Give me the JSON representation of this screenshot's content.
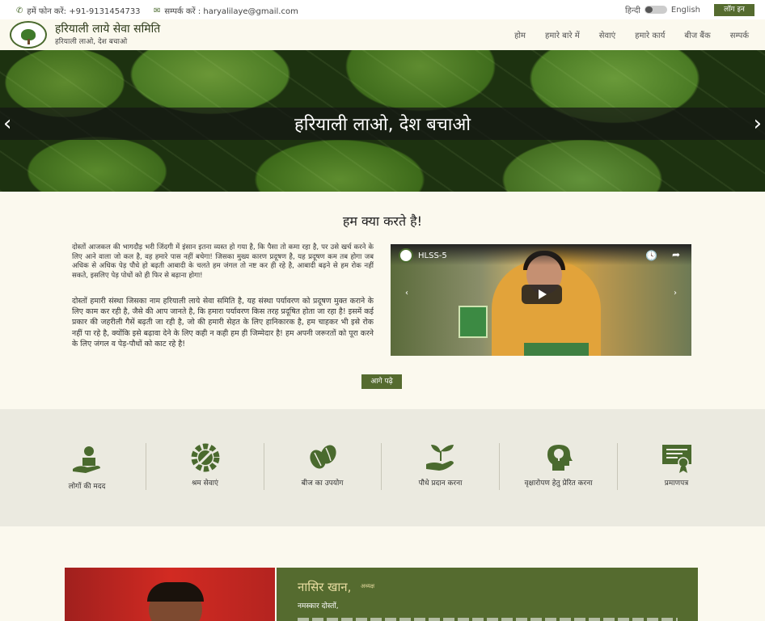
{
  "topbar": {
    "phone": "हमें फोन करें: +91-9131454733",
    "email": "सम्पर्क करें : haryalilaye@gmail.com",
    "lang_hindi": "हिन्दी",
    "lang_english": "English",
    "login_label": "लॉग इन"
  },
  "header": {
    "title": "हरियाली लाये सेवा समिति",
    "tagline": "हरियाली लाओ, देश बचाओ",
    "nav": [
      "होम",
      "हमारे बारे में",
      "सेवाएं",
      "हमारे कार्य",
      "बीज बैंक",
      "सम्पर्क"
    ]
  },
  "hero": {
    "title": "हरियाली लाओ, देश बचाओ",
    "prev": "‹",
    "next": "›"
  },
  "about": {
    "title": "हम क्या करते है!",
    "para1": "दोस्तों आजकल की भागदौड़ भरी जिंदगी में इंसान इतना व्यस्त हो गया है, कि पैसा तो कमा रहा है, पर उसे खर्च करने के लिए आने वाला जो कल है, वह हमारे पास नहीं बचेगा! जिसका मुख्य कारण प्रदूषण है, यह प्रदूषण कम तब होगा जब अधिक से अधिक पेड़ पौधे हो बढ़ती आबादी के चलते हम जंगल तो नष्ट कर ही रहे है, आबादी बढ़ने से हम रोक नहीं सकते, इसलिए पेड़ पोधों को ही फिर से बढ़ाना होगा!",
    "para2": "दोस्तों हमारी संस्था जिसका नाम हरियाली लाये सेवा समिति है, यह संस्था पर्यावरण को प्रदूषण मुक्त कराने के लिए काम कर रही है, जैसे की आप जानते है, कि हमारा पर्यावरण किस तरह प्रदूषित होता जा रहा है! इसमें कई प्रकार की जहरीली गैसें बढ़ती जा रही है, जो की हमारी सेहत के लिए हानिकारक है, हम चाहकर भी इसे रोक नहीं पा रहे है, क्योंकि इसे बढ़ावा देने के लिए कही न कही हम ही जिम्मेदार है! हम अपनी जरूरतों को पूरा करने के लिए जंगल व पेड़-पौधों को काट रहे है!",
    "video_title": "HLSS-5",
    "read_more": "आगे पढ़े"
  },
  "services": [
    {
      "label": "लोगों की मदद",
      "icon": "helping-hand-icon"
    },
    {
      "label": "श्रम सेवाएं",
      "icon": "gear-wrench-icon"
    },
    {
      "label": "बीज का उपयोग",
      "icon": "seeds-icon"
    },
    {
      "label": "पौधे प्रदान करना",
      "icon": "plant-hand-icon"
    },
    {
      "label": "वृक्षारोपण हेतु प्रेरित करना",
      "icon": "head-tree-icon"
    },
    {
      "label": "प्रमाणपत्र",
      "icon": "certificate-icon"
    }
  ],
  "profile": {
    "name": "नासिर खान,",
    "role": "अध्यक्ष",
    "greeting": "नमस्कार दोस्तों,"
  },
  "colors": {
    "primary": "#556b2f",
    "background": "#fbf9ee",
    "services_bg": "#ebeae0"
  }
}
